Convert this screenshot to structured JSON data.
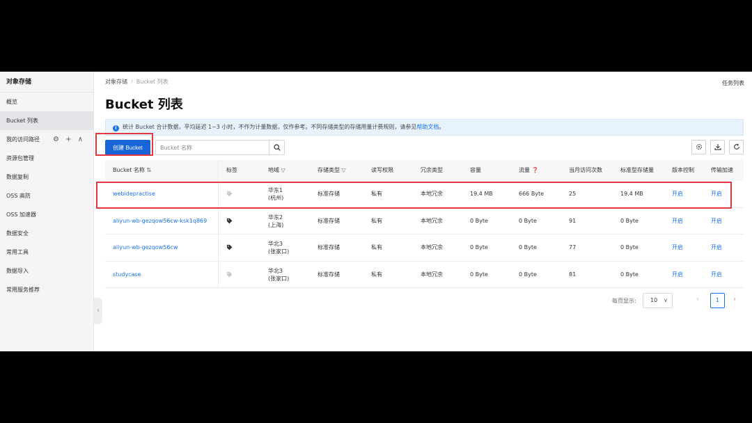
{
  "sidebar": {
    "title": "对象存储",
    "items": [
      {
        "label": "概览"
      },
      {
        "label": "Bucket 列表",
        "active": true
      },
      {
        "label": "我的访问路径"
      },
      {
        "label": "资源包管理"
      },
      {
        "label": "数据复制"
      },
      {
        "label": "OSS 高防"
      },
      {
        "label": "OSS 加速器"
      },
      {
        "label": "数据安全"
      },
      {
        "label": "常用工具"
      },
      {
        "label": "数据导入"
      },
      {
        "label": "常用服务推荐"
      }
    ],
    "path_tools": "⚙ + ∧"
  },
  "breadcrumb": {
    "root": "对象存储",
    "separator": "/",
    "current": "Bucket 列表"
  },
  "header": {
    "task_list": "任务列表",
    "title": "Bucket 列表"
  },
  "notice": {
    "text": "统计 Bucket 合计数据，平均延迟 1~3 小时，不作为计量数据，仅作参考。不同存储类型的存储用量计费规则，请参见",
    "link": "帮助文档",
    "suffix": "。"
  },
  "toolbar": {
    "create_label": "创建 Bucket",
    "search_placeholder": "Bucket 名称"
  },
  "table": {
    "headers": [
      "Bucket 名称",
      "标签",
      "地域",
      "存储类型",
      "读写权限",
      "冗余类型",
      "容量",
      "流量",
      "当月访问次数",
      "标准型存储量",
      "版本控制",
      "传输加速"
    ],
    "rows": [
      {
        "name": "webidepractise",
        "region_line1": "华东1",
        "region_line2": "(杭州)",
        "storage": "标准存储",
        "acl": "私有",
        "redundancy": "本地冗余",
        "capacity": "19.4 MB",
        "traffic": "666 Byte",
        "visits": "25",
        "standard": "19.4 MB",
        "versioning": "开启",
        "acceleration": "开启",
        "tag_color": "#c8c8c8"
      },
      {
        "name": "aliyun-wb-gezqow56cw-ksk1q869",
        "region_line1": "华东2",
        "region_line2": "(上海)",
        "storage": "标准存储",
        "acl": "私有",
        "redundancy": "本地冗余",
        "capacity": "0 Byte",
        "traffic": "0 Byte",
        "visits": "91",
        "standard": "0 Byte",
        "versioning": "开启",
        "acceleration": "开启",
        "tag_color": "#333333"
      },
      {
        "name": "aliyun-wb-gezqow56cw",
        "region_line1": "华北3",
        "region_line2": "(张家口)",
        "storage": "标准存储",
        "acl": "私有",
        "redundancy": "本地冗余",
        "capacity": "0 Byte",
        "traffic": "0 Byte",
        "visits": "77",
        "standard": "0 Byte",
        "versioning": "开启",
        "acceleration": "开启",
        "tag_color": "#333333"
      },
      {
        "name": "studycase",
        "region_line1": "华北3",
        "region_line2": "(张家口)",
        "storage": "标准存储",
        "acl": "私有",
        "redundancy": "本地冗余",
        "capacity": "0 Byte",
        "traffic": "0 Byte",
        "visits": "81",
        "standard": "0 Byte",
        "versioning": "开启",
        "acceleration": "开启",
        "tag_color": "#c8c8c8"
      }
    ]
  },
  "pagination": {
    "label": "每页显示:",
    "page_size": "10",
    "current_page": "1"
  },
  "colors": {
    "accent": "#1765d6",
    "link": "#1a73e8",
    "highlight": "#e5373f"
  }
}
